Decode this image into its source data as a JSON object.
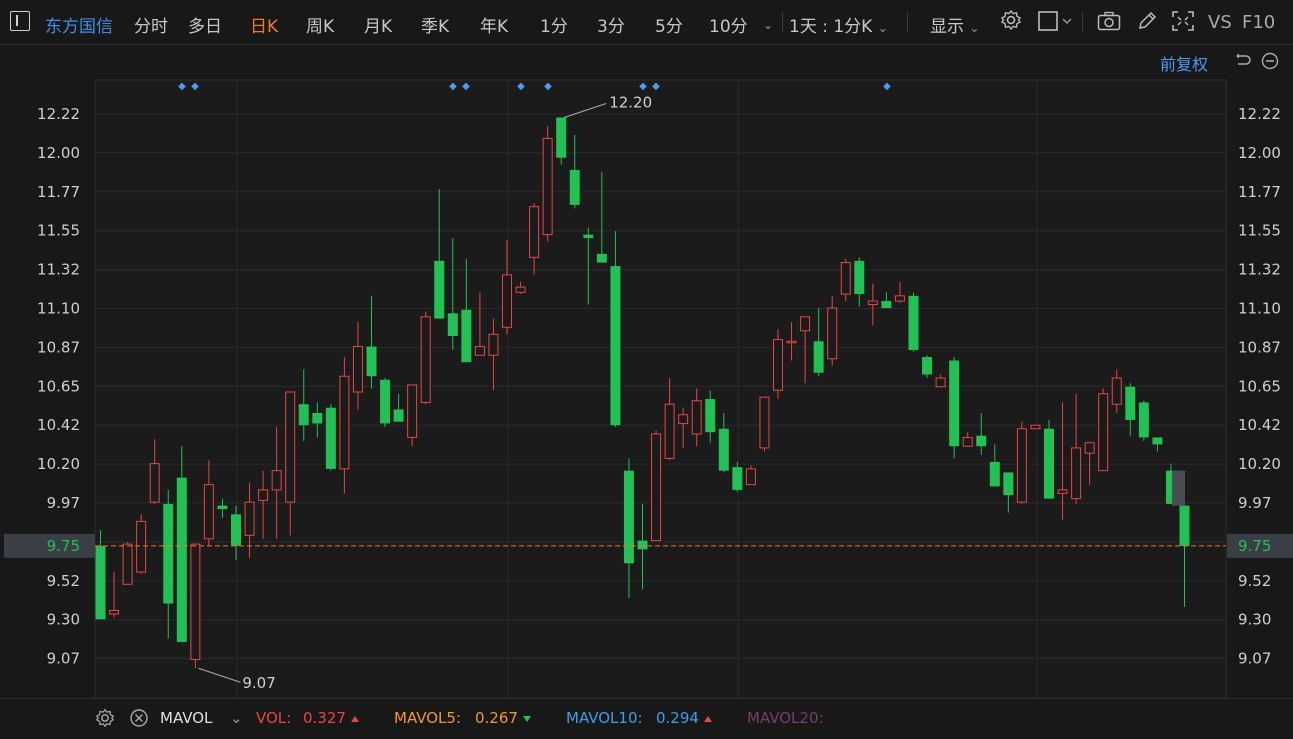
{
  "toolbar": {
    "stock_name": "东方国信",
    "tabs": [
      {
        "label": "分时"
      },
      {
        "label": "多日"
      },
      {
        "label": "日K",
        "active": true
      },
      {
        "label": "周K"
      },
      {
        "label": "月K"
      },
      {
        "label": "季K"
      },
      {
        "label": "年K"
      },
      {
        "label": "1分"
      },
      {
        "label": "3分"
      },
      {
        "label": "5分"
      },
      {
        "label": "10分"
      }
    ],
    "period_select": "1天 : 1分K",
    "display_label": "显示",
    "vs_label": "VS",
    "f10_label": "F10",
    "adjust_label": "前复权"
  },
  "colors": {
    "up": "#e64646",
    "down": "#21c155",
    "background": "#181818",
    "grid": "#2a2a2a",
    "current_price_line": "#f07a2a",
    "accent_blue": "#3d8fe8"
  },
  "chart_data": {
    "type": "candlestick",
    "current_price": "9.75",
    "y_ticks": [
      "12.22",
      "12.00",
      "11.77",
      "11.55",
      "11.32",
      "11.10",
      "10.87",
      "10.65",
      "10.42",
      "10.20",
      "9.97",
      "9.75",
      "9.52",
      "9.30",
      "9.07"
    ],
    "ylim": [
      8.85,
      12.4
    ],
    "annotations": {
      "high": "12.20",
      "low": "9.07"
    },
    "candles": [
      [
        9.75,
        9.84,
        9.33,
        9.33
      ],
      [
        9.36,
        9.6,
        9.34,
        9.38
      ],
      [
        9.53,
        9.77,
        9.53,
        9.76
      ],
      [
        9.6,
        9.93,
        9.59,
        9.89
      ],
      [
        10.0,
        10.36,
        9.99,
        10.22
      ],
      [
        9.99,
        10.07,
        9.22,
        9.42
      ],
      [
        10.14,
        10.32,
        9.2,
        9.2
      ],
      [
        9.1,
        9.73,
        9.05,
        9.76
      ],
      [
        9.79,
        10.24,
        9.75,
        10.1
      ],
      [
        9.98,
        10.02,
        9.91,
        9.96
      ],
      [
        9.93,
        9.98,
        9.67,
        9.75
      ],
      [
        9.81,
        10.11,
        9.68,
        10.0
      ],
      [
        10.01,
        10.18,
        9.79,
        10.07
      ],
      [
        10.07,
        10.43,
        9.79,
        10.18
      ],
      [
        10.0,
        10.63,
        9.81,
        10.63
      ],
      [
        10.56,
        10.76,
        10.35,
        10.44
      ],
      [
        10.51,
        10.57,
        10.37,
        10.45
      ],
      [
        10.54,
        10.56,
        10.18,
        10.19
      ],
      [
        10.19,
        10.83,
        10.05,
        10.72
      ],
      [
        10.63,
        11.03,
        10.53,
        10.89
      ],
      [
        10.89,
        11.18,
        10.65,
        10.72
      ],
      [
        10.7,
        10.71,
        10.43,
        10.45
      ],
      [
        10.53,
        10.62,
        10.47,
        10.46
      ],
      [
        10.37,
        10.64,
        10.32,
        10.67
      ],
      [
        10.57,
        11.09,
        10.56,
        11.06
      ],
      [
        11.38,
        11.79,
        11.06,
        11.05
      ],
      [
        11.08,
        11.51,
        10.87,
        10.95
      ],
      [
        11.1,
        11.39,
        10.82,
        10.8
      ],
      [
        10.84,
        11.2,
        10.85,
        10.89
      ],
      [
        10.84,
        11.05,
        10.64,
        10.96
      ],
      [
        11.0,
        11.5,
        10.96,
        11.3
      ],
      [
        11.2,
        11.26,
        11.19,
        11.23
      ],
      [
        11.4,
        11.71,
        11.3,
        11.69
      ],
      [
        11.53,
        12.15,
        11.49,
        12.08
      ],
      [
        12.2,
        12.2,
        11.93,
        11.97
      ],
      [
        11.9,
        12.1,
        11.68,
        11.7
      ],
      [
        11.53,
        11.57,
        11.13,
        11.51
      ],
      [
        11.42,
        11.89,
        11.37,
        11.37
      ],
      [
        11.35,
        11.55,
        10.43,
        10.44
      ],
      [
        10.18,
        10.25,
        9.45,
        9.65
      ],
      [
        9.78,
        9.99,
        9.5,
        9.73
      ],
      [
        9.78,
        10.41,
        9.78,
        10.39
      ],
      [
        10.25,
        10.71,
        10.24,
        10.56
      ],
      [
        10.45,
        10.54,
        10.31,
        10.5
      ],
      [
        10.39,
        10.65,
        10.32,
        10.58
      ],
      [
        10.59,
        10.64,
        10.34,
        10.4
      ],
      [
        10.42,
        10.51,
        10.17,
        10.18
      ],
      [
        10.2,
        10.23,
        10.06,
        10.07
      ],
      [
        10.1,
        10.21,
        10.1,
        10.19
      ],
      [
        10.31,
        10.6,
        10.29,
        10.6
      ],
      [
        10.64,
        10.99,
        10.59,
        10.93
      ],
      [
        10.92,
        11.03,
        10.81,
        10.92
      ],
      [
        10.98,
        11.05,
        10.68,
        11.06
      ],
      [
        10.92,
        11.11,
        10.72,
        10.74
      ],
      [
        10.82,
        11.18,
        10.78,
        11.11
      ],
      [
        11.19,
        11.39,
        11.15,
        11.37
      ],
      [
        11.38,
        11.4,
        11.12,
        11.19
      ],
      [
        11.13,
        11.25,
        11.01,
        11.15
      ],
      [
        11.15,
        11.2,
        11.12,
        11.11
      ],
      [
        11.15,
        11.26,
        11.14,
        11.18
      ],
      [
        11.18,
        11.2,
        10.86,
        10.87
      ],
      [
        10.83,
        10.84,
        10.71,
        10.73
      ],
      [
        10.66,
        10.73,
        10.66,
        10.71
      ],
      [
        10.81,
        10.83,
        10.25,
        10.32
      ],
      [
        10.32,
        10.4,
        10.32,
        10.37
      ],
      [
        10.38,
        10.51,
        10.27,
        10.32
      ],
      [
        10.23,
        10.33,
        10.09,
        10.09
      ],
      [
        10.17,
        10.17,
        9.94,
        10.04
      ],
      [
        10.0,
        10.46,
        9.99,
        10.42
      ],
      [
        10.42,
        10.47,
        10.47,
        10.44
      ],
      [
        10.42,
        10.47,
        10.02,
        10.02
      ],
      [
        10.05,
        10.57,
        9.9,
        10.07
      ],
      [
        10.02,
        10.62,
        9.99,
        10.31
      ],
      [
        10.28,
        10.32,
        10.1,
        10.34
      ],
      [
        10.18,
        10.65,
        10.18,
        10.62
      ],
      [
        10.56,
        10.76,
        10.51,
        10.71
      ],
      [
        10.66,
        10.68,
        10.38,
        10.47
      ],
      [
        10.57,
        10.58,
        10.35,
        10.37
      ],
      [
        10.37,
        10.37,
        10.29,
        10.33
      ],
      [
        10.18,
        10.22,
        9.99,
        9.99
      ],
      [
        9.98,
        10.04,
        9.4,
        9.75
      ]
    ]
  },
  "markers": {
    "symbol": "◆"
  },
  "indicator_bar": {
    "name": "MAVOL",
    "vol_label": "VOL:",
    "vol_value": "0.327",
    "mavol5_label": "MAVOL5:",
    "mavol5_value": "0.267",
    "mavol10_label": "MAVOL10:",
    "mavol10_value": "0.294",
    "mavol20_label": "MAVOL20:"
  }
}
